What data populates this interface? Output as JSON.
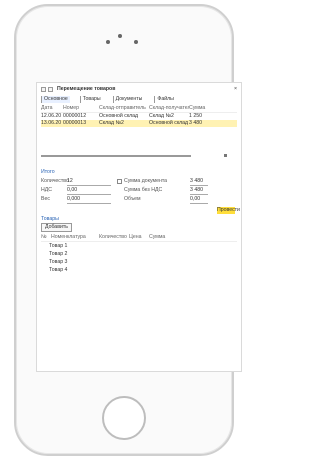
{
  "toolbar": {
    "title": "Перемещение товаров",
    "close": "×"
  },
  "tabs": [
    {
      "label": "Основное",
      "selected": true
    },
    {
      "label": "Товары"
    },
    {
      "label": "Документы"
    },
    {
      "label": "Файлы"
    }
  ],
  "table": {
    "headers": [
      "Дата",
      "Номер",
      "Склад-отправитель",
      "Склад-получатель",
      "Сумма"
    ],
    "rows": [
      [
        "12.06.20",
        "00000012",
        "Основной склад",
        "Склад №2",
        "1 250"
      ],
      [
        "13.06.20",
        "00000013",
        "Склад №2",
        "Основной склад",
        "3 480"
      ]
    ]
  },
  "section1": {
    "title": "Итого",
    "fields": [
      {
        "label": "Количество",
        "value": "12",
        "rlabel": "Сумма документа",
        "rvalue": "3 480"
      },
      {
        "label": "НДС",
        "value": "0,00",
        "rlabel": "Сумма без НДС",
        "rvalue": "3 480"
      },
      {
        "label": "Вес",
        "value": "0,000",
        "rlabel": "Объем",
        "rvalue": "0,00"
      }
    ],
    "yellow_button": "Провести"
  },
  "section2": {
    "title": "Товары",
    "add_button": "Добавить",
    "headers": [
      "№",
      "Номенклатура",
      "Количество",
      "Цена",
      "Сумма"
    ],
    "rows": [
      "Товар 1",
      "Товар 2",
      "Товар 3",
      "Товар 4"
    ]
  }
}
